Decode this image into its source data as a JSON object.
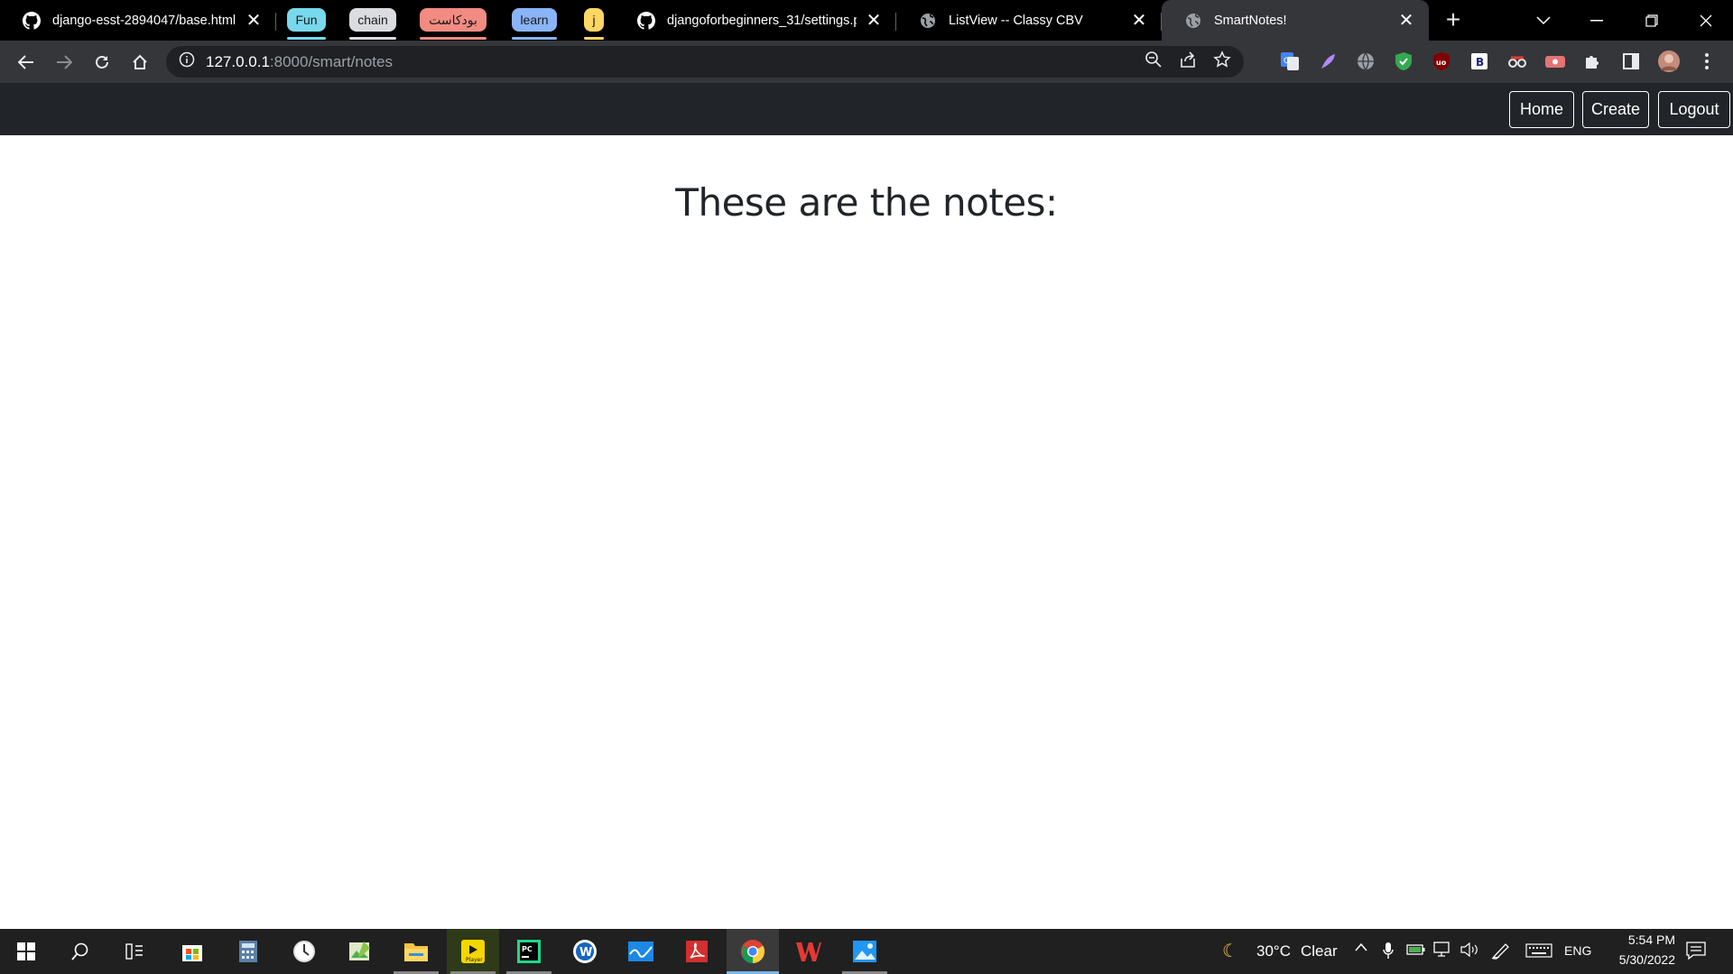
{
  "browser": {
    "tabs": [
      {
        "title": "django-esst-2894047/base.html a",
        "icon": "github-icon"
      },
      {
        "title": "djangoforbeginners_31/settings.p",
        "icon": "github-icon"
      },
      {
        "title": "ListView -- Classy CBV",
        "icon": "globe-icon"
      },
      {
        "title": "SmartNotes!",
        "icon": "globe-icon"
      }
    ],
    "tab_groups": [
      {
        "label": "Fun",
        "color": "#78d9ec"
      },
      {
        "label": "chain",
        "color": "#dadce0"
      },
      {
        "label": "بودکاست",
        "color": "#f28b82"
      },
      {
        "label": "learn",
        "color": "#8ab4f8"
      },
      {
        "label": "j",
        "color": "#fdd663"
      }
    ],
    "url_host": "127.0.0.1",
    "url_path": ":8000/smart/notes"
  },
  "navbar": {
    "home_label": "Home",
    "create_label": "Create",
    "logout_label": "Logout",
    "bg_color": "#212529"
  },
  "main": {
    "heading": "These are the notes:"
  },
  "taskbar": {
    "weather_temp": "30°C",
    "weather_desc": "Clear",
    "language": "ENG",
    "time": "5:54 PM",
    "date": "5/30/2022"
  }
}
